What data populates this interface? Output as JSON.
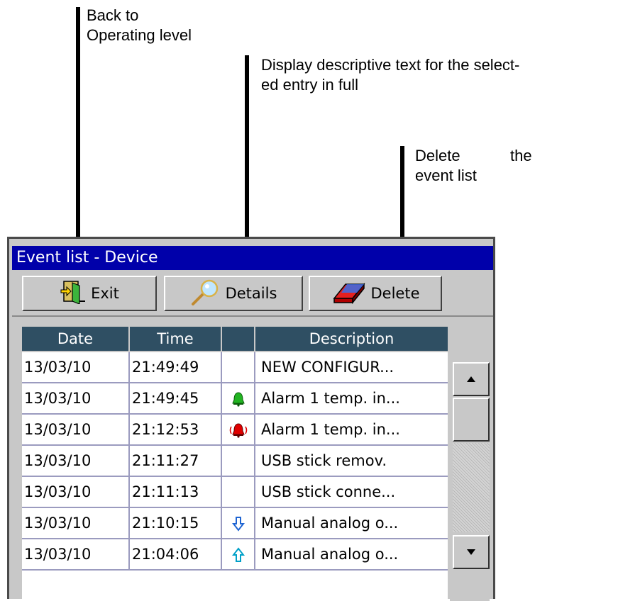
{
  "annotations": {
    "back": "Back to\nOperating level",
    "details": "Display descriptive text for the select-\ned entry in full",
    "delete_line1": "Delete",
    "delete_line1b": "the",
    "delete_line2": "event list"
  },
  "window": {
    "title": "Event list - Device"
  },
  "toolbar": {
    "exit_label": "Exit",
    "details_label": "Details",
    "delete_label": "Delete"
  },
  "table": {
    "columns": [
      "Date",
      "Time",
      "",
      "Description"
    ],
    "rows": [
      {
        "date": "13/03/10",
        "time": "21:49:49",
        "icon": "none",
        "description": "NEW CONFIGUR..."
      },
      {
        "date": "13/03/10",
        "time": "21:49:45",
        "icon": "alarm-off-bell-icon",
        "description": "Alarm 1  temp. in..."
      },
      {
        "date": "13/03/10",
        "time": "21:12:53",
        "icon": "alarm-on-bell-icon",
        "description": "Alarm 1  temp. in..."
      },
      {
        "date": "13/03/10",
        "time": "21:11:27",
        "icon": "none",
        "description": "USB stick remov."
      },
      {
        "date": "13/03/10",
        "time": "21:11:13",
        "icon": "none",
        "description": "USB stick conne..."
      },
      {
        "date": "13/03/10",
        "time": "21:10:15",
        "icon": "arrow-down-icon",
        "description": "Manual analog o..."
      },
      {
        "date": "13/03/10",
        "time": "21:04:06",
        "icon": "arrow-up-icon",
        "description": "Manual analog o..."
      }
    ]
  },
  "colors": {
    "titlebar": "#0000aa",
    "header": "#2f4f63",
    "panel": "#c8c8c8",
    "alarm_green": "#22b422",
    "alarm_red": "#e00000",
    "arrow_blue": "#1e64d2",
    "arrow_cyan": "#00a0c8"
  }
}
